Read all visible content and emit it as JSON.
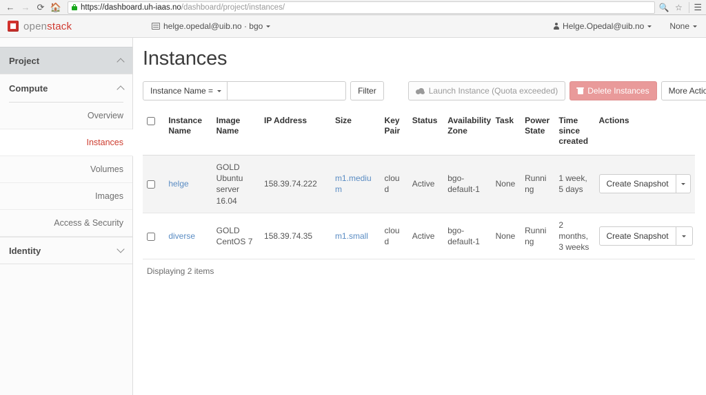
{
  "browser": {
    "back_icon": "back-arrow-icon",
    "forward_icon": "forward-arrow-icon",
    "reload_icon": "reload-icon",
    "home_icon": "home-icon",
    "lock_icon": "lock-icon",
    "url_scheme_host": "https://dashboard.uh-iaas.no",
    "url_path": "/dashboard/project/instances/",
    "zoom_icon": "zoom-icon",
    "bookmark_icon": "star-icon",
    "menu_icon": "hamburger-menu-icon"
  },
  "topbar": {
    "logo_open": "open",
    "logo_stack": "stack",
    "project_switcher": "helge.opedal@uib.no · bgo",
    "user_menu": "Helge.Opedal@uib.no",
    "region_menu": "None"
  },
  "sidebar": {
    "project_label": "Project",
    "compute_label": "Compute",
    "identity_label": "Identity",
    "links": [
      {
        "label": "Overview",
        "active": false
      },
      {
        "label": "Instances",
        "active": true
      },
      {
        "label": "Volumes",
        "active": false
      },
      {
        "label": "Images",
        "active": false
      },
      {
        "label": "Access & Security",
        "active": false
      }
    ]
  },
  "main": {
    "page_title": "Instances",
    "toolbar": {
      "filter_type": "Instance Name =",
      "filter_input_value": "",
      "filter_input_placeholder": "",
      "filter_button": "Filter",
      "launch_button": "Launch Instance (Quota exceeded)",
      "delete_button": "Delete Instances",
      "more_actions_button": "More Actions"
    },
    "table": {
      "headers": [
        "Instance Name",
        "Image Name",
        "IP Address",
        "Size",
        "Key Pair",
        "Status",
        "Availability Zone",
        "Task",
        "Power State",
        "Time since created",
        "Actions"
      ],
      "rows": [
        {
          "selected": false,
          "highlighted": true,
          "instance_name": "helge",
          "image_name": "GOLD Ubuntu server 16.04",
          "ip_address": "158.39.74.222",
          "size": "m1.medium",
          "key_pair": "cloud",
          "status": "Active",
          "availability_zone": "bgo-default-1",
          "task": "None",
          "power_state": "Running",
          "time_since_created": "1 week, 5 days",
          "action_label": "Create Snapshot"
        },
        {
          "selected": false,
          "highlighted": false,
          "instance_name": "diverse",
          "image_name": "GOLD CentOS 7",
          "ip_address": "158.39.74.35",
          "size": "m1.small",
          "key_pair": "cloud",
          "status": "Active",
          "availability_zone": "bgo-default-1",
          "task": "None",
          "power_state": "Running",
          "time_since_created": "2 months, 3 weeks",
          "action_label": "Create Snapshot"
        }
      ]
    },
    "footer_count": "Displaying 2 items"
  },
  "colors": {
    "brand_red": "#cf3a30",
    "active_link": "#cd3c2e",
    "table_link": "#5a8cc3",
    "danger_button": "#e99a9a",
    "lock_green": "#18a81c"
  }
}
